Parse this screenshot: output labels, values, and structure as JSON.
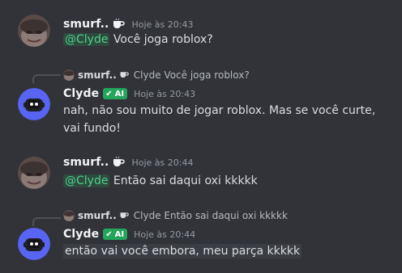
{
  "colors": {
    "background": "#313338",
    "username": "#f2f3f5",
    "timestamp": "#949ba4",
    "ai_tag": "#23a55a",
    "mention_text": "#4fd08a"
  },
  "messages": [
    {
      "author": "smurf..",
      "author_icon": "coffee-cup-icon",
      "timestamp": "Hoje às 20:43",
      "mention": "@Clyde",
      "text": " Você joga roblox?"
    },
    {
      "reply": {
        "author": "smurf..",
        "text": "Clyde Você joga roblox?"
      },
      "author": "Clyde",
      "tag": "AI",
      "timestamp": "Hoje às 20:43",
      "text": "nah, não sou muito de jogar roblox. Mas se você curte, vai fundo!"
    },
    {
      "author": "smurf..",
      "author_icon": "coffee-cup-icon",
      "timestamp": "Hoje às 20:44",
      "mention": "@Clyde",
      "text": " Então sai daqui oxi kkkkk"
    },
    {
      "reply": {
        "author": "smurf..",
        "text": "Clyde Então sai daqui oxi kkkkk"
      },
      "author": "Clyde",
      "tag": "AI",
      "timestamp": "Hoje às 20:44",
      "text": "então vai você embora, meu parça kkkkk"
    }
  ]
}
